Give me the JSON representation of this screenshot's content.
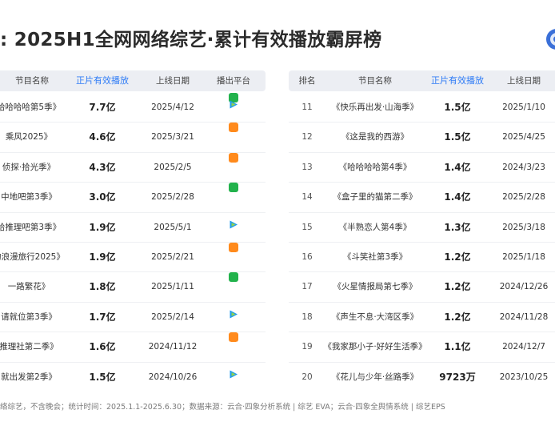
{
  "title": ": 2025H1全网网络综艺·累计有效播放霸屏榜",
  "left": {
    "headers": {
      "name": "节目名称",
      "value": "正片有效播放",
      "date": "上线日期",
      "platform": "播出平台"
    },
    "rows": [
      {
        "name": "哈哈哈哈第5季》",
        "value": "7.7亿",
        "date": "2025/4/12",
        "platforms": [
          "iqiyi-icon",
          "tencent-icon"
        ]
      },
      {
        "name": "乘风2025》",
        "value": "4.6亿",
        "date": "2025/3/21",
        "platforms": [
          "mango-icon"
        ]
      },
      {
        "name": "侦探·拾光季》",
        "value": "4.3亿",
        "date": "2025/2/5",
        "platforms": [
          "mango-icon"
        ]
      },
      {
        "name": "中地吧第3季》",
        "value": "3.0亿",
        "date": "2025/2/28",
        "platforms": [
          "iqiyi-icon"
        ]
      },
      {
        "name": "给推理吧第3季》",
        "value": "1.9亿",
        "date": "2025/5/1",
        "platforms": [
          "tencent-icon"
        ]
      },
      {
        "name": "的浪漫旅行2025》",
        "value": "1.9亿",
        "date": "2025/2/21",
        "platforms": [
          "mango-icon"
        ]
      },
      {
        "name": "一路繁花》",
        "value": "1.8亿",
        "date": "2025/1/11",
        "platforms": [
          "iqiyi-icon"
        ]
      },
      {
        "name": "请就位第3季》",
        "value": "1.7亿",
        "date": "2025/2/14",
        "platforms": [
          "tencent-icon"
        ]
      },
      {
        "name": "推理社第二季》",
        "value": "1.6亿",
        "date": "2024/11/12",
        "platforms": [
          "mango-icon"
        ]
      },
      {
        "name": "就出发第2季》",
        "value": "1.5亿",
        "date": "2024/10/26",
        "platforms": [
          "tencent-icon"
        ]
      }
    ]
  },
  "right": {
    "headers": {
      "rank": "排名",
      "name": "节目名称",
      "value": "正片有效播放",
      "date": "上线日期"
    },
    "rows": [
      {
        "rank": "11",
        "name": "《快乐再出发·山海季》",
        "value": "1.5亿",
        "date": "2025/1/10"
      },
      {
        "rank": "12",
        "name": "《这是我的西游》",
        "value": "1.5亿",
        "date": "2025/4/25"
      },
      {
        "rank": "13",
        "name": "《哈哈哈哈第4季》",
        "value": "1.4亿",
        "date": "2024/3/23"
      },
      {
        "rank": "14",
        "name": "《盒子里的猫第二季》",
        "value": "1.4亿",
        "date": "2025/2/28"
      },
      {
        "rank": "15",
        "name": "《半熟恋人第4季》",
        "value": "1.3亿",
        "date": "2025/3/18"
      },
      {
        "rank": "16",
        "name": "《斗笑社第3季》",
        "value": "1.2亿",
        "date": "2025/1/18"
      },
      {
        "rank": "17",
        "name": "《火星情报局第七季》",
        "value": "1.2亿",
        "date": "2024/12/26"
      },
      {
        "rank": "18",
        "name": "《声生不息·大湾区季》",
        "value": "1.2亿",
        "date": "2024/11/28"
      },
      {
        "rank": "19",
        "name": "《我家那小子·好好生活季》",
        "value": "1.1亿",
        "date": "2024/12/7"
      },
      {
        "rank": "20",
        "name": "《花儿与少年·丝路季》",
        "value": "9723万",
        "date": "2023/10/25"
      }
    ]
  },
  "footer": "络综艺，不含晚会；统计时间：2025.1.1-2025.6.30；数据来源：云合·四象分析系统 | 综艺 EVA；云合·四象全舆情系统 | 综艺EPS",
  "colors": {
    "accent": "#2f7cf6",
    "iqiyi": "#22b24c",
    "mango": "#ff8a1c",
    "tencent": "#1e9bf0"
  }
}
